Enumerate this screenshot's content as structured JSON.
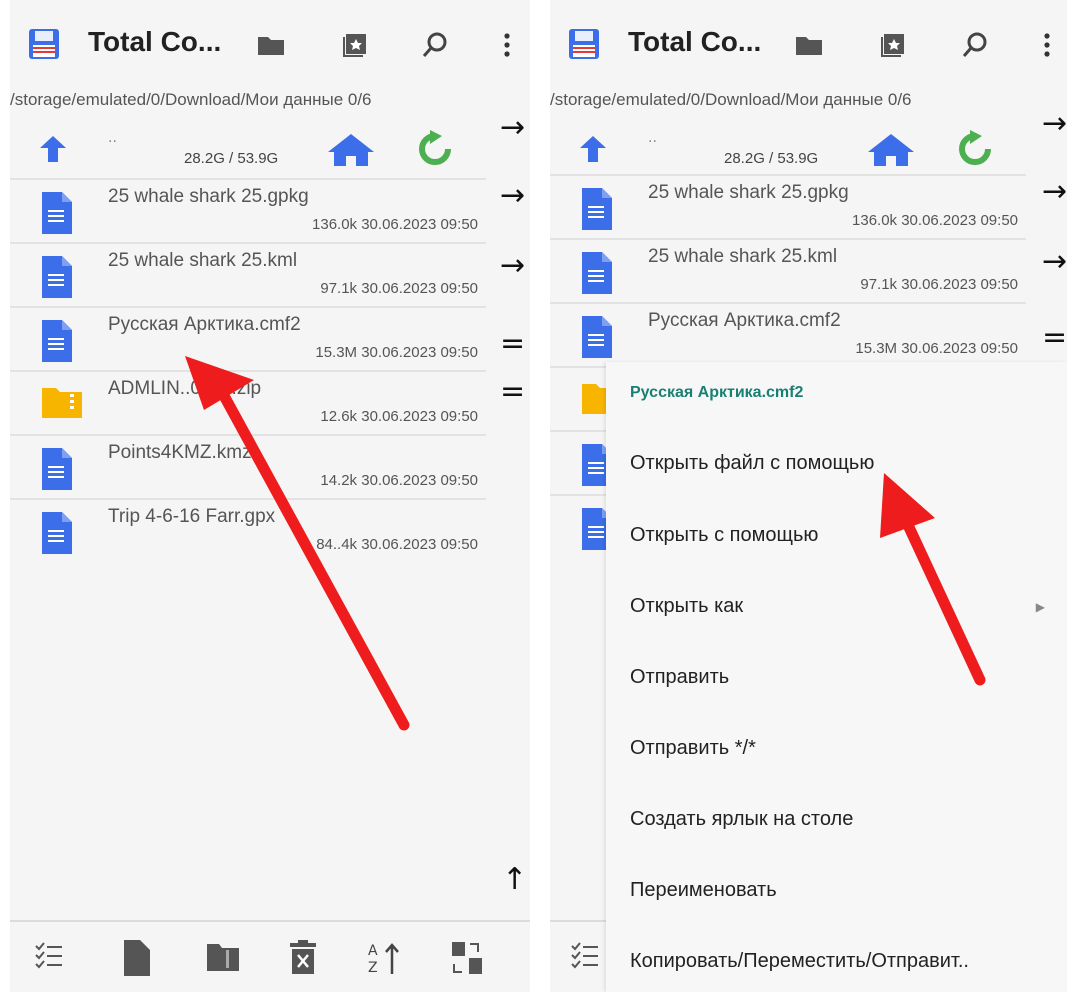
{
  "app": {
    "title": "Total Co..."
  },
  "path": "/storage/emulated/0/Download/Мои данные  0/6",
  "updir": {
    "label": "..",
    "space": "28.2G / 53.9G"
  },
  "files": [
    {
      "name": "25 whale shark 25.gpkg",
      "meta": "136.0k  30.06.2023  09:50",
      "icon": "document-icon"
    },
    {
      "name": "25 whale shark 25.kml",
      "meta": "97.1k  30.06.2023  09:50",
      "icon": "document-icon"
    },
    {
      "name": "Русская Арктика.cmf2",
      "meta": "15.3M  30.06.2023  09:50",
      "icon": "document-icon"
    },
    {
      "name": "ADMLIN..0k_0.zip",
      "meta": "12.6k  30.06.2023  09:50",
      "icon": "zip-folder-icon"
    },
    {
      "name": "Points4KMZ.kmz",
      "meta": "14.2k  30.06.2023  09:50",
      "icon": "document-icon"
    },
    {
      "name": "Trip 4-6-16 Farr.gpx",
      "meta": "84..4k  30.06.2023  09:50",
      "icon": "document-icon"
    }
  ],
  "side_buttons": [
    "→",
    "→",
    "→",
    "=",
    "=",
    "↑"
  ],
  "context_menu": {
    "header": "Русская Арктика.cmf2",
    "items": [
      "Открыть файл с помощью",
      "Открыть с помощью",
      "Открыть как",
      "Отправить",
      "Отправить */*",
      "Создать ярлык на столе",
      "Переименовать",
      "Копировать/Переместить/Отправит.."
    ]
  },
  "colors": {
    "accent_blue": "#3b6ee8",
    "green": "#4caf50",
    "folder_yellow": "#f7b500",
    "arrow_red": "#ee1c1c",
    "header_teal": "#1a7f73"
  }
}
